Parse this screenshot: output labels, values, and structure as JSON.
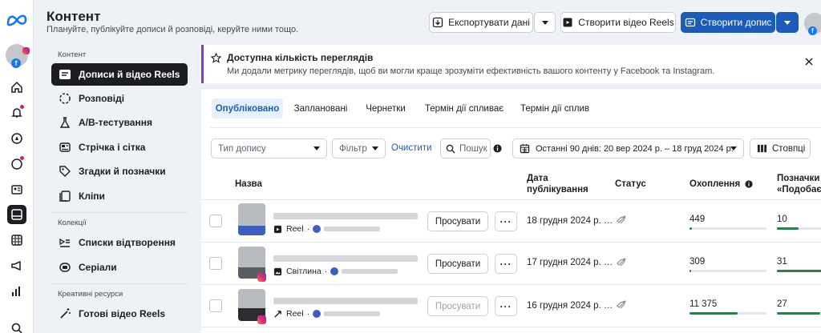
{
  "header": {
    "title": "Контент",
    "subtitle": "Плануйте, публікуйте дописи й розповіді, керуйте ними тощо.",
    "export_label": "Експортувати дані",
    "create_reel_label": "Створити відео Reels",
    "create_post_label": "Створити допис"
  },
  "menu": {
    "section_content": "Контент",
    "items": [
      {
        "label": "Дописи й відео Reels"
      },
      {
        "label": "Розповіді"
      },
      {
        "label": "A/B-тестування"
      },
      {
        "label": "Стрічка і сітка"
      },
      {
        "label": "Згадки й позначки"
      },
      {
        "label": "Кліпи"
      }
    ],
    "section_collections": "Колекції",
    "collections": [
      {
        "label": "Списки відтворення"
      },
      {
        "label": "Серіали"
      }
    ],
    "section_creative": "Креативні ресурси",
    "creative": [
      {
        "label": "Готові відео Reels"
      }
    ]
  },
  "banner": {
    "title": "Доступна кількість переглядів",
    "text": "Ми додали метрику переглядів, щоб ви могли краще зрозуміти ефективність вашого контенту у Facebook та Instagram."
  },
  "tabs": [
    {
      "label": "Опубліковано",
      "active": true
    },
    {
      "label": "Заплановані"
    },
    {
      "label": "Чернетки"
    },
    {
      "label": "Термін дії спливає"
    },
    {
      "label": "Термін дії сплив"
    }
  ],
  "filters": {
    "post_type_placeholder": "Тип допису",
    "filter_label": "Фільтр",
    "clear_label": "Очистити",
    "search_placeholder": "Пошук",
    "date_range": "Останні 90 днів: 20 вер 2024 р. – 18 груд 2024 р.",
    "columns_label": "Стовпці"
  },
  "table": {
    "headers": {
      "name": "Назва",
      "date_line1": "Дата",
      "date_line2": "публікування",
      "status": "Статус",
      "reach": "Охоплення",
      "likes_line1": "Позначки",
      "likes_line2": "«Подобає"
    },
    "rows": [
      {
        "type": "Reel",
        "promote": "Просувати",
        "date": "18 грудня 2024 р. …",
        "reach": "449",
        "reach_frac": 0.03,
        "likes": "10",
        "likes_frac": 0.45,
        "promote_enabled": true
      },
      {
        "type": "Світлина",
        "promote": "Просувати",
        "date": "17 грудня 2024 р. …",
        "reach": "309",
        "reach_frac": 0.02,
        "likes": "31",
        "likes_frac": 1.0,
        "promote_enabled": true
      },
      {
        "type": "Reel",
        "promote": "Просувати",
        "date": "16 грудня 2024 р. …",
        "reach": "11 375",
        "reach_frac": 0.62,
        "likes": "27",
        "likes_frac": 0.9,
        "promote_enabled": false
      }
    ]
  },
  "colors": {
    "accent": "#1c5cb8",
    "active_tab_bg": "#e7f0fd",
    "bar": "#2e7d4f"
  }
}
